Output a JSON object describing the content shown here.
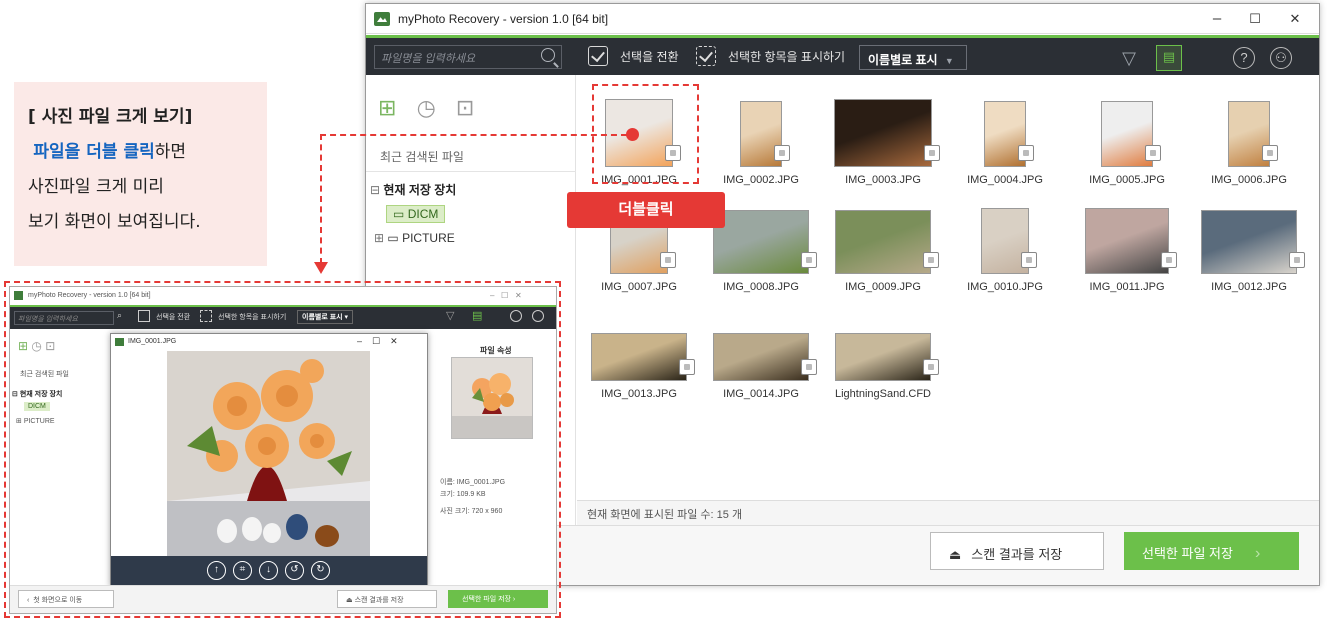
{
  "caption": {
    "line1": "[ 사진 파일 크게 보기]",
    "line2_blue": "파일을 더블 클릭",
    "line2_rest": "하면",
    "line3": "사진파일 크게 미리",
    "line4": "보기 화면이 보여집니다."
  },
  "window": {
    "title": "myPhoto Recovery - version 1.0 [64 bit]",
    "minimize": "–",
    "maximize": "☐",
    "close": "✕"
  },
  "toolbar": {
    "search_placeholder": "파일명을 입력하세요",
    "toggle_select": "선택을 전환",
    "show_selected": "선택한 항목을 표시하기",
    "sort_label": "이름별로 표시",
    "sort_arrow": "▼",
    "filter_icon": "▽",
    "help_icon": "?",
    "user_icon": "⚇"
  },
  "sidebar": {
    "recent_label": "최근 검색된 파일",
    "storage_label": "현재 저장 장치",
    "tree": [
      {
        "label": "DICM",
        "selected": true
      },
      {
        "label": "PICTURE",
        "selected": false
      }
    ]
  },
  "files": [
    "IMG_0001.JPG",
    "IMG_0002.JPG",
    "IMG_0003.JPG",
    "IMG_0004.JPG",
    "IMG_0005.JPG",
    "IMG_0006.JPG",
    "IMG_0007.JPG",
    "IMG_0008.JPG",
    "IMG_0009.JPG",
    "IMG_0010.JPG",
    "IMG_0011.JPG",
    "IMG_0012.JPG",
    "IMG_0013.JPG",
    "IMG_0014.JPG",
    "LightningSand.CFD"
  ],
  "status": {
    "text": "현재 화면에 표시된 파일 수: 15 개"
  },
  "buttons": {
    "save_scan": "스캔 결과를 저장",
    "save_selected": "선택한 파일 저장",
    "save_selected_arrow": "›"
  },
  "callout": {
    "double_click": "더블클릭"
  },
  "mini": {
    "title": "myPhoto Recovery - version 1.0 [64 bit]",
    "search": "파일명을 입력하세요",
    "toggle": "선택을 전환",
    "show_sel": "선택한 항목을 표시하기",
    "sort": "이름별로 표시",
    "recent": "최근 검색된 파일",
    "storage": "현재 저장 장치",
    "dicm": "DICM",
    "picture": "PICTURE",
    "popup_title": "IMG_0001.JPG",
    "props_title": "파일 속성",
    "prop_name": "이름: IMG_0001.JPG",
    "prop_size": "크기: 109.9 KB",
    "prop_dims": "사진 크기: 720 x 960",
    "back": "첫 화면으로 이동",
    "save_scan": "스캔 결과를 저장",
    "save_sel": "선택한 파일 저장"
  },
  "colors": {
    "accent": "#6cc04a",
    "toolbar_bg": "#2b2f35",
    "callout": "#e53935",
    "caption_bg": "#fbe9e7"
  }
}
